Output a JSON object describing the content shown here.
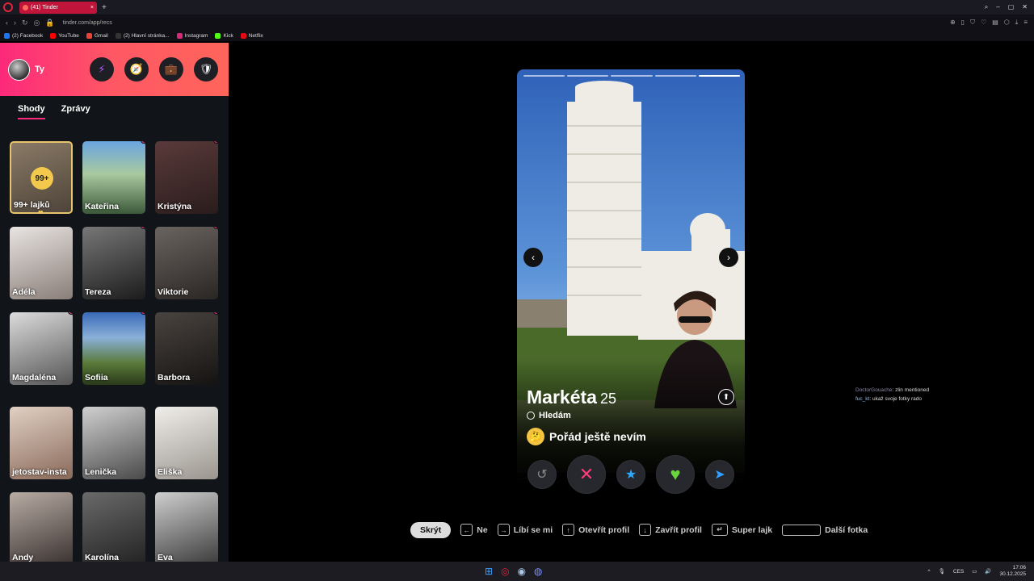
{
  "browser": {
    "tab_title": "(41) Tinder",
    "url": "tinder.com/app/recs",
    "bookmarks": [
      "(2) Facebook",
      "YouTube",
      "Gmail",
      "(2) Hlavní stránka...",
      "Instagram",
      "Kick",
      "Netflix"
    ]
  },
  "sidebar": {
    "user_name": "Ty",
    "tabs": [
      "Shody",
      "Zprávy"
    ],
    "likes_count": "99+",
    "likes_label": "99+ lajků",
    "matches": [
      "Kateřina",
      "Kristýna",
      "Adéla",
      "Tereza",
      "Viktorie",
      "Magdaléna",
      "Sofiia",
      "Barbora",
      "jetostav-insta",
      "Lenička",
      "Eliška",
      "Andy",
      "Karolína",
      "Eva"
    ]
  },
  "profile": {
    "name": "Markéta",
    "age": "25",
    "seeking_label": "Hledám",
    "intent": "Pořád ještě nevím",
    "photo_count": 5,
    "active_photo": 5
  },
  "overlay_chat": [
    {
      "user": "DoctorGouache",
      "text": ": zlin mentioned"
    },
    {
      "user": "fuc_kt",
      "text": ": ukaž svoje fotky rado"
    }
  ],
  "shortcuts": {
    "hide": "Skrýt",
    "nope": "Ne",
    "like": "Líbí se mi",
    "open": "Otevřít profil",
    "close": "Zavřít profil",
    "super": "Super lajk",
    "next": "Další fotka"
  },
  "taskbar": {
    "lang": "CES",
    "time": "17:06",
    "date": "30.12.2025"
  }
}
